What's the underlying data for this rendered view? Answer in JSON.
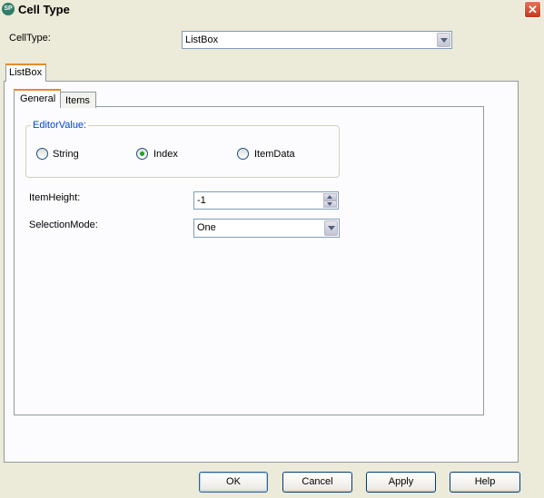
{
  "window": {
    "title": "Cell Type",
    "icon_text": "SP",
    "close_glyph": "✕"
  },
  "celltype": {
    "label": "CellType:",
    "value": "ListBox"
  },
  "outer_tab": {
    "label": "ListBox"
  },
  "inner_tabs": [
    {
      "label": "General",
      "selected": true
    },
    {
      "label": "Items",
      "selected": false
    }
  ],
  "editor_value": {
    "legend": "EditorValue:",
    "options": [
      "String",
      "Index",
      "ItemData"
    ],
    "selected": "Index"
  },
  "item_height": {
    "label": "ItemHeight:",
    "value": "-1"
  },
  "selection_mode": {
    "label": "SelectionMode:",
    "value": "One"
  },
  "buttons": {
    "ok": "OK",
    "cancel": "Cancel",
    "apply": "Apply",
    "help": "Help"
  },
  "colors": {
    "accent_tab": "#e68b2c",
    "group_legend": "#0046d5",
    "radio_dot": "#21a121",
    "close_button": "#c1391b"
  }
}
